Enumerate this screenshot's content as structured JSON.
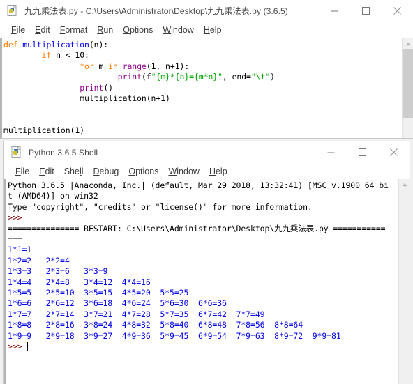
{
  "editor_window": {
    "icon": "python-idle-icon",
    "title": "九九乘法表.py - C:\\Users\\Administrator\\Desktop\\九九乘法表.py (3.6.5)",
    "controls": {
      "minimize": "minimize-icon",
      "maximize": "maximize-icon",
      "close": "close-icon"
    },
    "menu": [
      {
        "accel": "F",
        "rest": "ile"
      },
      {
        "accel": "E",
        "rest": "dit"
      },
      {
        "accel": "F",
        "rest": "ormat",
        "pre": ""
      },
      {
        "accel": "R",
        "rest": "un"
      },
      {
        "accel": "O",
        "rest": "ptions"
      },
      {
        "accel": "W",
        "rest": "indow"
      },
      {
        "accel": "H",
        "rest": "elp"
      }
    ],
    "menu_labels": [
      "File",
      "Edit",
      "Format",
      "Run",
      "Options",
      "Window",
      "Help"
    ],
    "code_lines": [
      {
        "indent": 0,
        "tokens": [
          {
            "t": "def ",
            "c": "kw"
          },
          {
            "t": "multiplication",
            "c": "fn"
          },
          {
            "t": "(n):",
            "c": ""
          }
        ]
      },
      {
        "indent": 0,
        "tokens": [
          {
            "t": "        ",
            "c": ""
          },
          {
            "t": "if",
            "c": "kw"
          },
          {
            "t": " n < 10:",
            "c": ""
          }
        ]
      },
      {
        "indent": 0,
        "tokens": [
          {
            "t": "                ",
            "c": ""
          },
          {
            "t": "for",
            "c": "kw"
          },
          {
            "t": " m ",
            "c": ""
          },
          {
            "t": "in",
            "c": "kw"
          },
          {
            "t": " ",
            "c": ""
          },
          {
            "t": "range",
            "c": "bi"
          },
          {
            "t": "(1, n+1):",
            "c": ""
          }
        ]
      },
      {
        "indent": 0,
        "tokens": [
          {
            "t": "                        ",
            "c": ""
          },
          {
            "t": "print",
            "c": "bi"
          },
          {
            "t": "(f",
            "c": ""
          },
          {
            "t": "\"{m}*{n}={m*n}\"",
            "c": "str"
          },
          {
            "t": ", end=",
            "c": ""
          },
          {
            "t": "\"\\t\"",
            "c": "str"
          },
          {
            "t": ")",
            "c": ""
          }
        ]
      },
      {
        "indent": 0,
        "tokens": [
          {
            "t": "                ",
            "c": ""
          },
          {
            "t": "print",
            "c": "bi"
          },
          {
            "t": "()",
            "c": ""
          }
        ]
      },
      {
        "indent": 0,
        "tokens": [
          {
            "t": "                multiplication(n+1)",
            "c": ""
          }
        ]
      },
      {
        "indent": 0,
        "tokens": [
          {
            "t": "",
            "c": ""
          }
        ]
      },
      {
        "indent": 0,
        "tokens": [
          {
            "t": "",
            "c": ""
          }
        ]
      },
      {
        "indent": 0,
        "tokens": [
          {
            "t": "multiplication(1)",
            "c": ""
          }
        ]
      }
    ]
  },
  "shell_window": {
    "icon": "python-idle-icon",
    "title": "Python 3.6.5 Shell",
    "controls": {
      "minimize": "minimize-icon",
      "maximize": "maximize-icon",
      "close": "close-icon"
    },
    "menu_labels": [
      "File",
      "Edit",
      "Shell",
      "Debug",
      "Options",
      "Window",
      "Help"
    ],
    "banner": [
      "Python 3.6.5 |Anaconda, Inc.| (default, Mar 29 2018, 13:32:41) [MSC v.1900 64 bi",
      "t (AMD64)] on win32",
      "Type \"copyright\", \"credits\" or \"license()\" for more information."
    ],
    "prompt": ">>>",
    "restart_line_1": "=============== RESTART: C:\\Users\\Administrator\\Desktop\\九九乘法表.py ===========",
    "restart_line_2": "===",
    "table_rows": [
      "1*1=1",
      "1*2=2\t2*2=4",
      "1*3=3\t2*3=6\t3*3=9",
      "1*4=4\t2*4=8\t3*4=12\t4*4=16",
      "1*5=5\t2*5=10\t3*5=15\t4*5=20\t5*5=25",
      "1*6=6\t2*6=12\t3*6=18\t4*6=24\t5*6=30\t6*6=36",
      "1*7=7\t2*7=14\t3*7=21\t4*7=28\t5*7=35\t6*7=42\t7*7=49",
      "1*8=8\t2*8=16\t3*8=24\t4*8=32\t5*8=40\t6*8=48\t7*8=56\t8*8=64",
      "1*9=9\t2*9=18\t3*9=27\t4*9=36\t5*9=45\t6*9=54\t7*9=63\t8*9=72\t9*9=81"
    ],
    "final_prompt": ">>> "
  },
  "colors": {
    "keyword": "#ff7700",
    "definition": "#0000ff",
    "builtin": "#900090",
    "string": "#00aa00",
    "output": "#0000ee",
    "prompt": "#770000",
    "window_border": "#c9c9c9",
    "chrome_bg": "#ffffff"
  }
}
